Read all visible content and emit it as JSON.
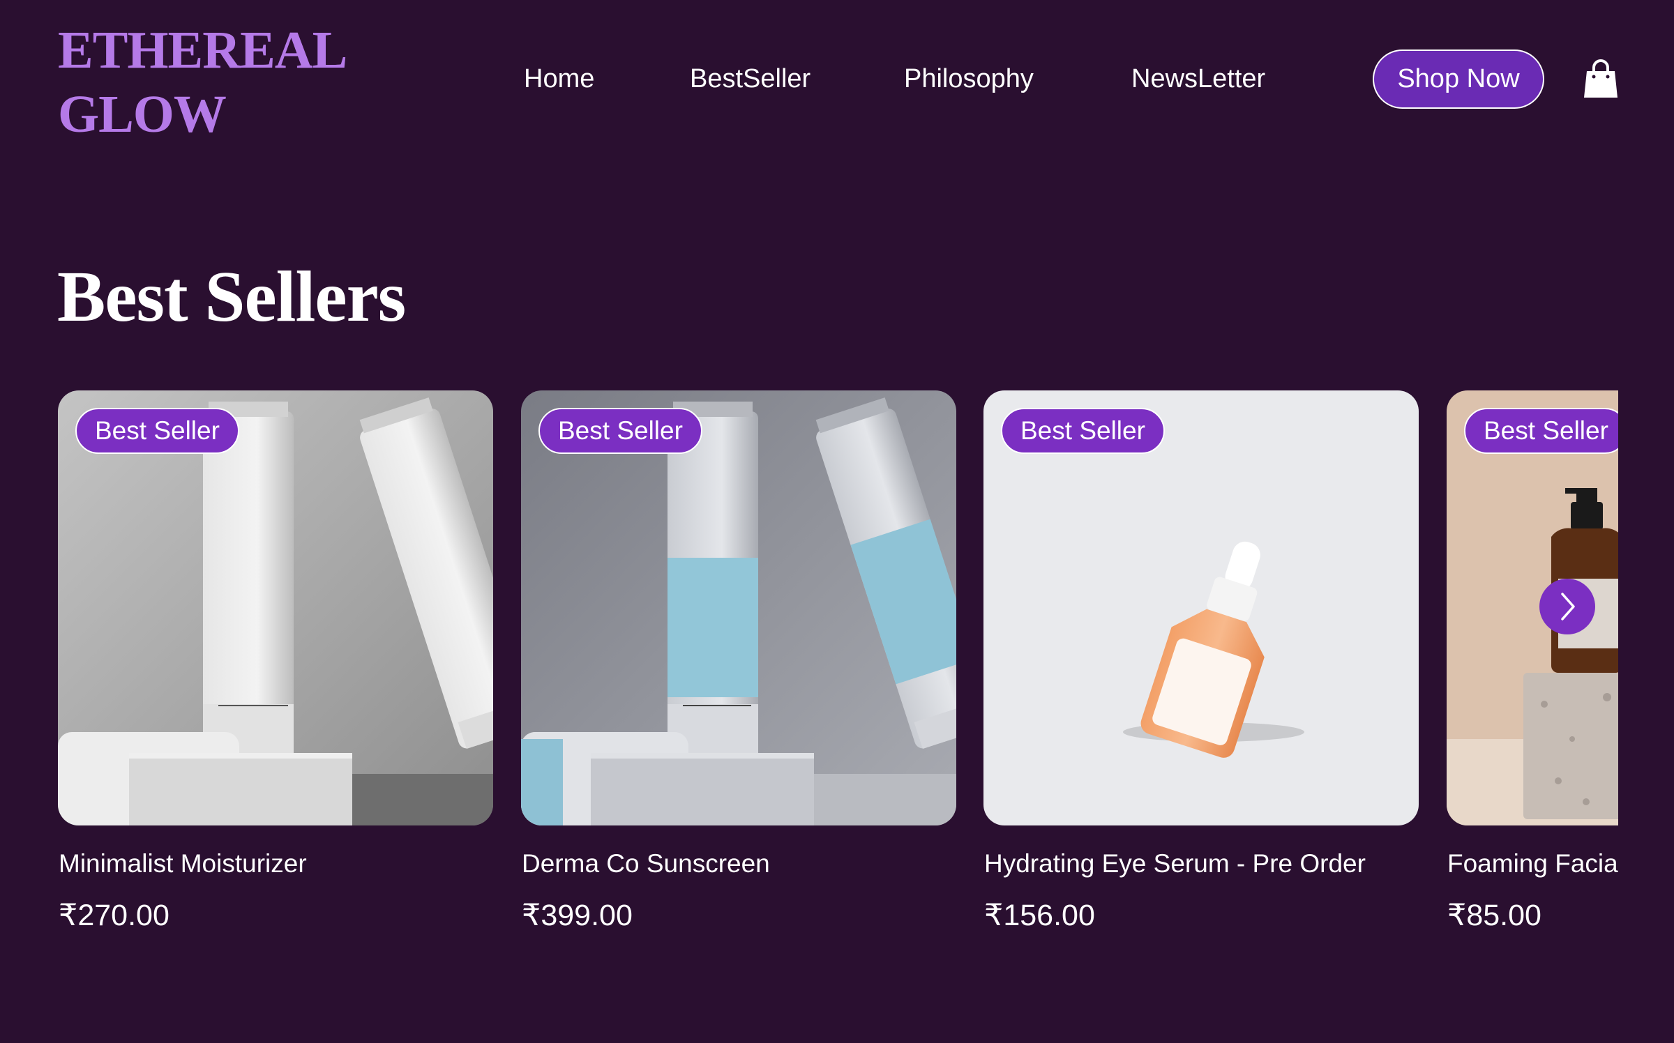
{
  "brand": {
    "line1": "ETHEREAL",
    "line2": "GLOW"
  },
  "nav": {
    "items": [
      "Home",
      "BestSeller",
      "Philosophy",
      "NewsLetter"
    ]
  },
  "header": {
    "shop_label": "Shop Now",
    "cart_icon": "shopping-bag-icon"
  },
  "colors": {
    "background": "#2a0f30",
    "accent": "#7b2fc2",
    "logo": "#b57ae8"
  },
  "section": {
    "title": "Best Sellers"
  },
  "products": [
    {
      "badge": "Best Seller",
      "name": "Minimalist Moisturizer",
      "price": "₹270.00"
    },
    {
      "badge": "Best Seller",
      "name": "Derma Co Sunscreen",
      "price": "₹399.00"
    },
    {
      "badge": "Best Seller",
      "name": "Hydrating Eye Serum - Pre Order",
      "price": "₹156.00"
    },
    {
      "badge": "Best Seller",
      "name": "Foaming Facial Cleanser",
      "price": "₹85.00"
    }
  ],
  "carousel": {
    "next_icon": "chevron-right-icon"
  }
}
